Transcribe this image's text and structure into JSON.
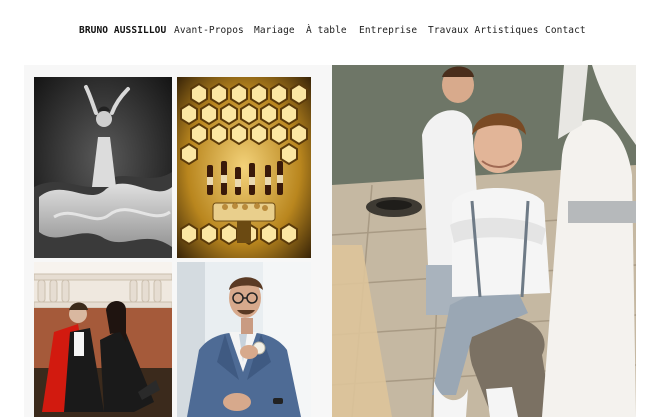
{
  "nav": {
    "items": [
      {
        "label": "BRUNO AUSSILLOU"
      },
      {
        "label": "Avant-Propos"
      },
      {
        "label": "Mariage"
      },
      {
        "label": "À table"
      },
      {
        "label": "Entreprise"
      },
      {
        "label": "Travaux Artistiques"
      },
      {
        "label": "Contact"
      }
    ]
  },
  "gallery": {
    "photos": [
      {
        "subject": "dancer in flowing white dress, black and white"
      },
      {
        "subject": "wine bottles in illuminated hexagonal cellar"
      },
      {
        "subject": "two women in costumes on balustrade terrace"
      },
      {
        "subject": "groom in blue suit adjusting boutonniere"
      },
      {
        "subject": "boy in white shirt sitting on stone"
      }
    ]
  },
  "colors": {
    "background": "#ffffff",
    "text": "#222222",
    "gallery_background": "#f7f7f7"
  }
}
